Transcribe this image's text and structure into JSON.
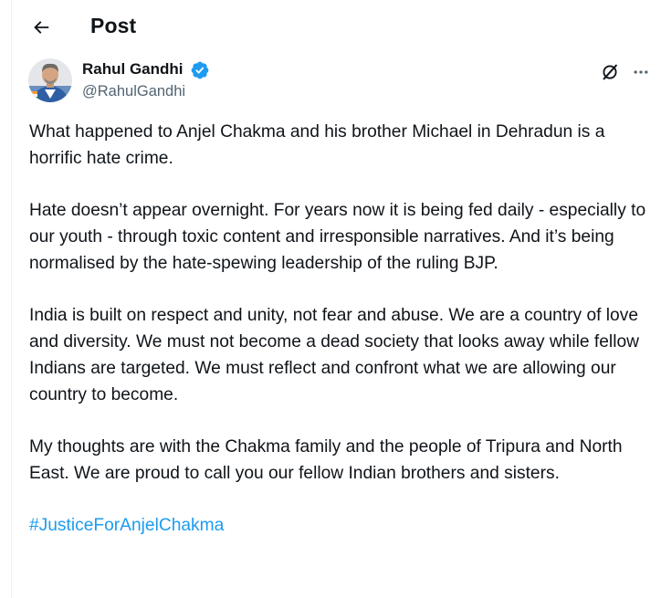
{
  "header": {
    "title": "Post",
    "back_icon": "arrow-left-icon"
  },
  "author": {
    "display_name": "Rahul Gandhi",
    "handle": "@RahulGandhi",
    "verified_icon": "verified-badge-icon",
    "verified_color": "#1d9bf0"
  },
  "actions": {
    "grok_icon": "grok-icon",
    "more_icon": "more-horizontal-icon"
  },
  "tweet": {
    "paragraphs": [
      "What happened to Anjel Chakma and his brother Michael in Dehradun is a horrific hate crime.",
      "Hate doesn’t appear overnight. For years now it is being fed daily - especially to our youth - through toxic content and irresponsible narratives. And it’s being normalised by the hate-spewing leadership of the ruling BJP.",
      "India is built on respect and unity, not fear and abuse. We are a country of love and diversity. We must not become a dead society that looks away while fellow Indians are targeted. We must reflect and confront what we are allowing our country to become.",
      "My thoughts are with the Chakma family and the people of Tripura and North East. We are proud to call you our fellow Indian brothers and sisters."
    ],
    "hashtag": "#JusticeForAnjelChakma",
    "hashtag_color": "#1d9bf0"
  }
}
